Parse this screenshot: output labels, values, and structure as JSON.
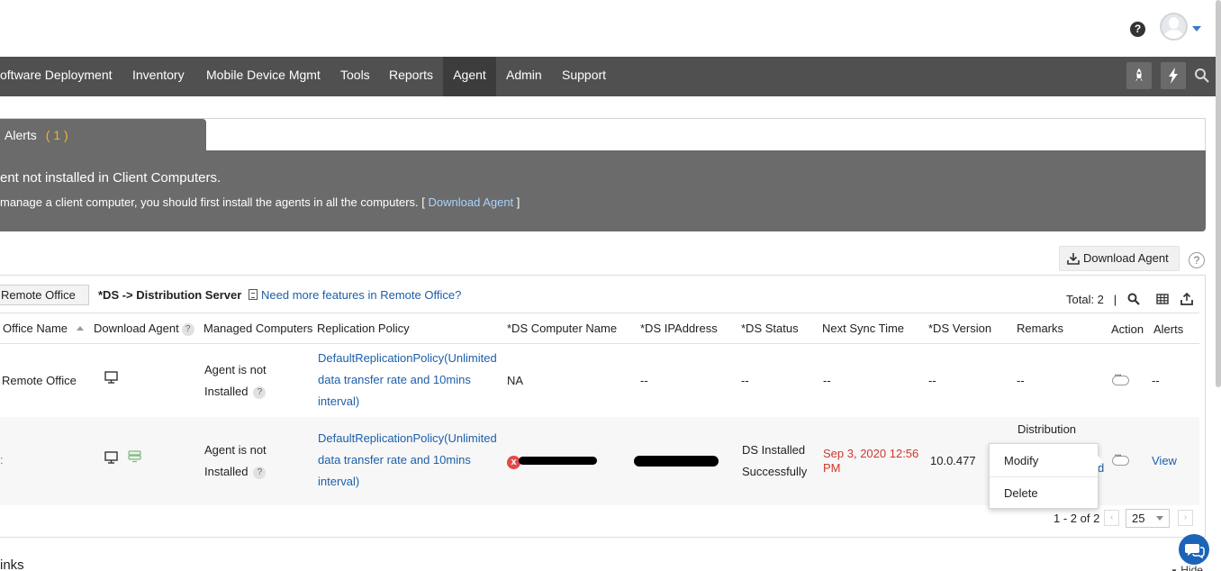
{
  "header": {
    "help_icon": "?"
  },
  "nav": {
    "items": [
      "oftware Deployment",
      "Inventory",
      "Mobile Device Mgmt",
      "Tools",
      "Reports",
      "Agent",
      "Admin",
      "Support"
    ],
    "active": "Agent",
    "active_bg": "#3c3c3c",
    "icons": [
      "rocket-icon",
      "bolt-icon",
      "search-icon"
    ]
  },
  "alerts": {
    "tab_label": "Alerts",
    "count": "( 1 )",
    "title": "ent not installed in Client Computers.",
    "desc_prefix": "manage a client computer, you should first install the agents in all the computers. [ ",
    "link_text": "Download Agent",
    "desc_suffix": " ]"
  },
  "toolbar": {
    "download_agent_label": "Download Agent",
    "help": "?"
  },
  "table": {
    "tab_label": "Remote Office",
    "ds_label": "*DS -> Distribution Server",
    "features_link": "Need more features in Remote Office?",
    "total_label": "Total: 2",
    "separator": "|",
    "columns": [
      "Office Name",
      "Download Agent",
      "Managed Computers",
      "Replication Policy",
      "*DS Computer Name",
      "*DS IPAddress",
      "*DS Status",
      "Next Sync Time",
      "*DS Version",
      "Remarks",
      "Action",
      "Alerts"
    ],
    "col_help": "?",
    "rows": [
      {
        "office_name": "Remote Office",
        "managed_1": "Agent is not",
        "managed_2": "Installed",
        "policy_1": "DefaultReplicationPolicy(Unlimited",
        "policy_2": "data transfer rate and 10mins",
        "policy_3": "interval)",
        "ds_computer": "NA",
        "ds_ip": "--",
        "ds_status": "--",
        "next_sync": "--",
        "ds_version": "--",
        "remarks": "--",
        "alerts": "--"
      },
      {
        "office_name": ":",
        "managed_1": "Agent is not",
        "managed_2": "Installed",
        "policy_1": "DefaultReplicationPolicy(Unlimited",
        "policy_2": "data transfer rate and 10mins",
        "policy_3": "interval)",
        "ds_status_1": "DS Installed",
        "ds_status_2": "Successfully",
        "next_sync_1": "Sep 3, 2020 12:56",
        "next_sync_2": "PM",
        "ds_version": "10.0.477",
        "remarks_1": "Distribution",
        "remarks_partial": "d",
        "alerts_link": "View",
        "error_icon": "x"
      }
    ]
  },
  "context_menu": {
    "modify": "Modify",
    "delete": "Delete"
  },
  "pagination": {
    "range": "1 - 2 of 2",
    "page_size": "25",
    "prev": "‹",
    "next": "›"
  },
  "bottom": {
    "links_label": "inks",
    "hide_label": "Hide"
  },
  "colors": {
    "link": "#1d5fa8",
    "alert_count": "#f0b429",
    "next_sync": "#d0362c",
    "chat": "#1c64b7"
  }
}
